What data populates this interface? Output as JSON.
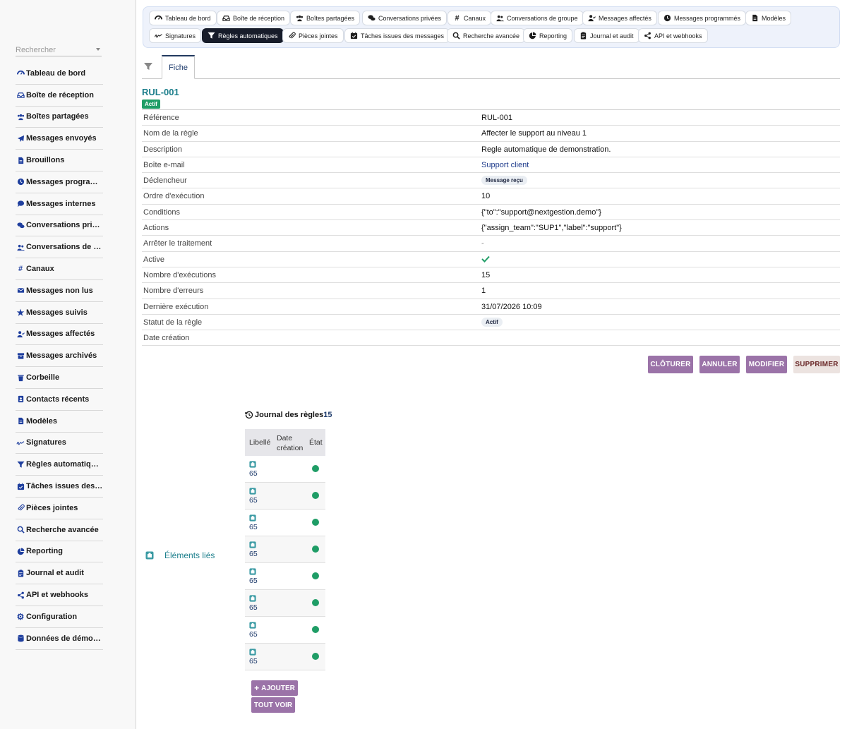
{
  "sidebar": {
    "search_placeholder": "Rechercher",
    "items": [
      {
        "label": "Tableau de bord",
        "icon": "dashboard-icon"
      },
      {
        "label": "Boîte de réception",
        "icon": "inbox-icon"
      },
      {
        "label": "Boîtes partagées",
        "icon": "users-icon"
      },
      {
        "label": "Messages envoyés",
        "icon": "paper-plane-icon"
      },
      {
        "label": "Brouillons",
        "icon": "file-icon"
      },
      {
        "label": "Messages programmés",
        "icon": "clock-icon"
      },
      {
        "label": "Messages internes",
        "icon": "comment-icon"
      },
      {
        "label": "Conversations privées",
        "icon": "comments-icon"
      },
      {
        "label": "Conversations de groupe",
        "icon": "user-group-icon"
      },
      {
        "label": "Canaux",
        "icon": "hashtag-icon"
      },
      {
        "label": "Messages non lus",
        "icon": "envelope-icon"
      },
      {
        "label": "Messages suivis",
        "icon": "star-icon"
      },
      {
        "label": "Messages affectés",
        "icon": "user-check-icon"
      },
      {
        "label": "Messages archivés",
        "icon": "archive-icon"
      },
      {
        "label": "Corbeille",
        "icon": "trash-icon"
      },
      {
        "label": "Contacts récents",
        "icon": "contact-card-icon"
      },
      {
        "label": "Modèles",
        "icon": "file-icon"
      },
      {
        "label": "Signatures",
        "icon": "signature-icon"
      },
      {
        "label": "Règles automatiques",
        "icon": "filter-icon"
      },
      {
        "label": "Tâches issues des messages",
        "icon": "calendar-check-icon"
      },
      {
        "label": "Pièces jointes",
        "icon": "paperclip-icon"
      },
      {
        "label": "Recherche avancée",
        "icon": "search-icon"
      },
      {
        "label": "Reporting",
        "icon": "pie-chart-icon"
      },
      {
        "label": "Journal et audit",
        "icon": "clipboard-icon"
      },
      {
        "label": "API et webhooks",
        "icon": "share-nodes-icon"
      },
      {
        "label": "Configuration",
        "icon": "gear-icon"
      },
      {
        "label": "Données de démonstration",
        "icon": "database-icon"
      }
    ]
  },
  "topnav": {
    "chips": [
      {
        "label": "Tableau de bord",
        "icon": "dashboard-icon"
      },
      {
        "label": "Boîte de réception",
        "icon": "inbox-icon"
      },
      {
        "label": "Boîtes partagées",
        "icon": "users-icon"
      },
      {
        "label": "Conversations privées",
        "icon": "comments-icon"
      },
      {
        "label": "Canaux",
        "icon": "hashtag-icon"
      },
      {
        "label": "Conversations de groupe",
        "icon": "user-group-icon"
      },
      {
        "label": "Messages affectés",
        "icon": "user-check-icon"
      },
      {
        "label": "Messages programmés",
        "icon": "clock-icon"
      },
      {
        "label": "Modèles",
        "icon": "file-icon"
      },
      {
        "label": "Signatures",
        "icon": "signature-icon"
      },
      {
        "label": "Règles automatiques",
        "icon": "filter-icon",
        "active": true
      },
      {
        "label": "Pièces jointes",
        "icon": "paperclip-icon"
      },
      {
        "label": "Tâches issues des messages",
        "icon": "calendar-check-icon"
      },
      {
        "label": "Recherche avancée",
        "icon": "search-icon"
      },
      {
        "label": "Reporting",
        "icon": "pie-chart-icon"
      },
      {
        "label": "Journal et audit",
        "icon": "clipboard-icon"
      },
      {
        "label": "API et webhooks",
        "icon": "share-nodes-icon"
      }
    ]
  },
  "tabs": {
    "fiche": "Fiche"
  },
  "record": {
    "ref": "RUL-001",
    "status_badge": "Actif",
    "fields": [
      {
        "key": "Référence",
        "value": "RUL-001"
      },
      {
        "key": "Nom de la règle",
        "value": "Affecter le support au niveau 1"
      },
      {
        "key": "Description",
        "value": "Regle automatique de demonstration."
      },
      {
        "key": "Boîte e-mail",
        "value": "Support client",
        "kind": "link"
      },
      {
        "key": "Déclencheur",
        "value": "Message reçu",
        "kind": "pill"
      },
      {
        "key": "Ordre d'exécution",
        "value": "10"
      },
      {
        "key": "Conditions",
        "value": "{\"to\":\"support@nextgestion.demo\"}"
      },
      {
        "key": "Actions",
        "value": "{\"assign_team\":\"SUP1\",\"label\":\"support\"}"
      },
      {
        "key": "Arrêter le traitement",
        "value": "-",
        "kind": "dash"
      },
      {
        "key": "Active",
        "value": "",
        "kind": "check"
      },
      {
        "key": "Nombre d'exécutions",
        "value": "15"
      },
      {
        "key": "Nombre d'erreurs",
        "value": "1"
      },
      {
        "key": "Dernière exécution",
        "value": "31/07/2026 10:09"
      },
      {
        "key": "Statut de la règle",
        "value": "Actif",
        "kind": "pill"
      },
      {
        "key": "Date création",
        "value": ""
      }
    ]
  },
  "actions": {
    "close": "CLÔTURER",
    "cancel": "ANNULER",
    "edit": "MODIFIER",
    "delete": "SUPPRIMER"
  },
  "linked": {
    "label": "Éléments liés",
    "journal_title": "Journal des règles",
    "journal_count": "15",
    "columns": [
      "Libellé",
      "Date création",
      "État"
    ],
    "rows": [
      "65",
      "65",
      "65",
      "65",
      "65",
      "65",
      "65",
      "65"
    ],
    "add": "AJOUTER",
    "see_all": "TOUT VOIR"
  },
  "colors": {
    "accent": "#9b73a8",
    "success": "#1f9d66",
    "title": "#1d7f8c",
    "active_chip": "#171c2a"
  }
}
